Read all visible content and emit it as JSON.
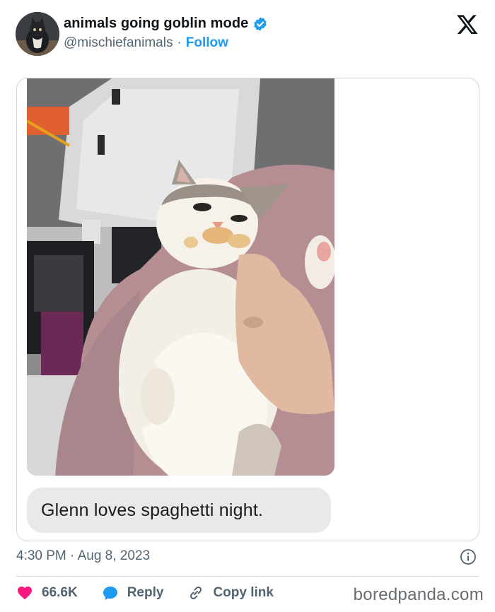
{
  "author": {
    "display_name": "animals going goblin mode",
    "handle": "@mischiefanimals",
    "separator": "·",
    "follow_label": "Follow"
  },
  "media": {
    "caption": "Glenn loves spaghetti night."
  },
  "meta": {
    "timestamp": "4:30 PM · Aug 8, 2023"
  },
  "actions": {
    "likes": "66.6K",
    "reply_label": "Reply",
    "copy_link_label": "Copy link"
  },
  "watermark": "boredpanda.com",
  "colors": {
    "accent": "#1d9bf0",
    "like": "#f91880",
    "muted": "#536471",
    "text": "#0f1419"
  },
  "icons": {
    "logo": "x-logo-icon",
    "verified": "verified-badge-icon",
    "info": "info-icon",
    "like": "heart-icon",
    "reply": "speech-bubble-icon",
    "copy": "link-icon"
  }
}
